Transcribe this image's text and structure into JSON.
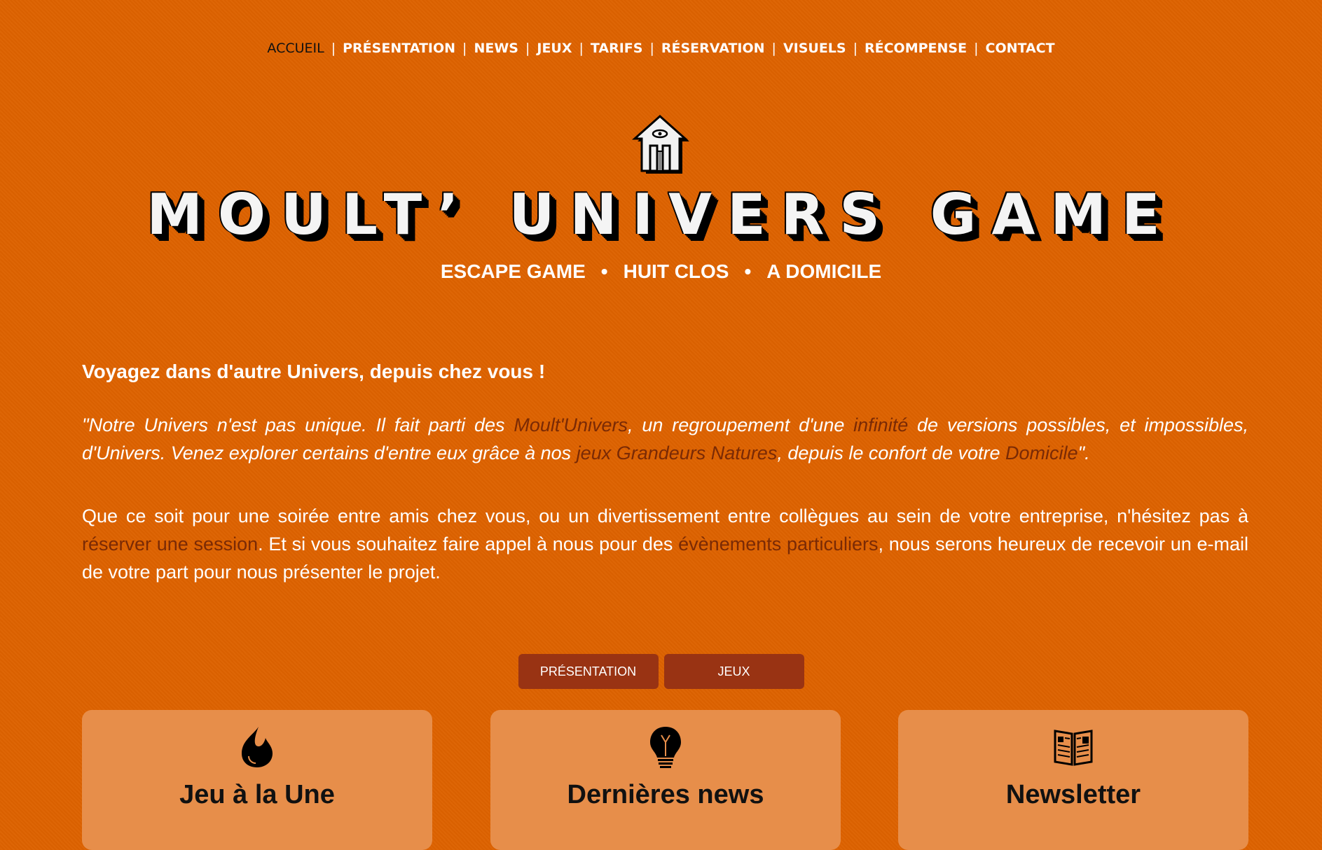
{
  "nav": {
    "items": [
      {
        "label": "ACCUEIL",
        "active": true
      },
      {
        "label": "PRÉSENTATION"
      },
      {
        "label": "NEWS"
      },
      {
        "label": "JEUX"
      },
      {
        "label": "TARIFS"
      },
      {
        "label": "RÉSERVATION"
      },
      {
        "label": "VISUELS"
      },
      {
        "label": "RÉCOMPENSE"
      },
      {
        "label": "CONTACT"
      }
    ],
    "separator": "|"
  },
  "brand": {
    "title": "MOULT’ UNIVERS GAME",
    "tagline": [
      "ESCAPE GAME",
      "HUIT CLOS",
      "A DOMICILE"
    ],
    "tagline_sep": "•"
  },
  "intro": {
    "lead": "Voyagez dans d'autre Univers, depuis chez vous !",
    "quote": {
      "p1": "\"Notre Univers n'est pas unique. Il fait parti des ",
      "l1": "Moult'Univers",
      "p2": ", un regroupement d'une ",
      "l2": "infinité",
      "p3": " de versions possibles, et impossibles, d'Univers. Venez explorer certains d'entre eux grâce à nos ",
      "l3": "jeux Grandeurs Natures",
      "p4": ", depuis le confort de votre ",
      "l4": "Domicile",
      "p5": "\"."
    },
    "paragraph": {
      "p1": "Que ce soit pour une soirée entre amis chez vous, ou un divertissement entre collègues au sein de votre entreprise, n'hésitez pas à ",
      "l1": "réserver une session",
      "p2": ". Et si vous souhaitez faire appel à nous pour des ",
      "l2": "évènements particuliers",
      "p3": ", nous serons heureux de recevoir un e-mail de votre part pour nous présenter le projet."
    }
  },
  "buttons": {
    "presentation": "PRÉSENTATION",
    "jeux": "JEUX"
  },
  "cards": [
    {
      "icon": "flame-icon",
      "title": "Jeu à la Une"
    },
    {
      "icon": "lightbulb-icon",
      "title": "Dernières news"
    },
    {
      "icon": "newspaper-icon",
      "title": "Newsletter"
    }
  ],
  "colors": {
    "background": "#dd6200",
    "link": "#7a2a05",
    "button": "#993313",
    "card": "#e78e4a"
  }
}
